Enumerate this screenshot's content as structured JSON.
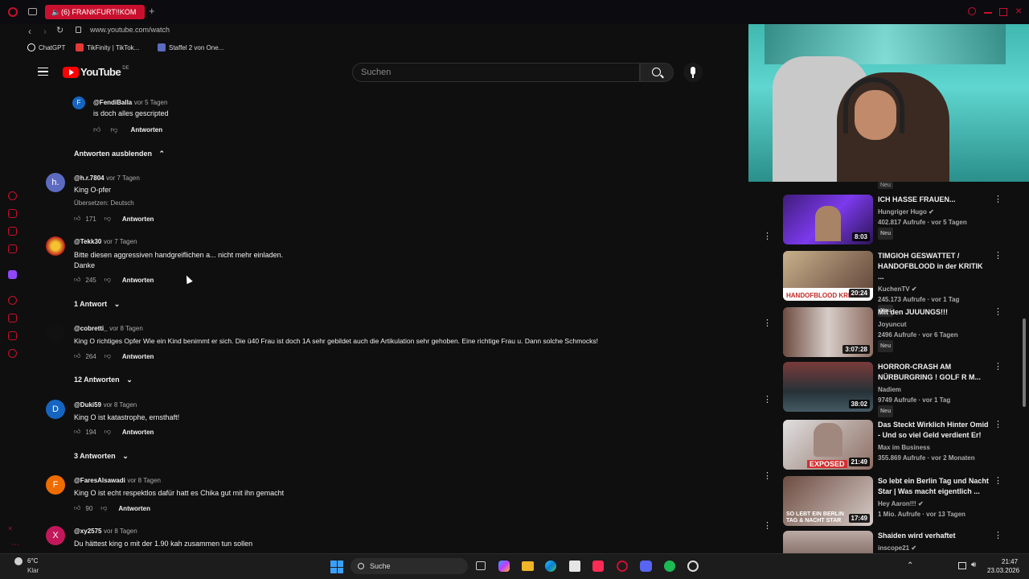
{
  "browser": {
    "tab_title": "(6) FRANKFURT!!KOM",
    "url": "www.youtube.com/watch",
    "bookmarks": [
      {
        "label": "ChatGPT",
        "color": "#ffffff"
      },
      {
        "label": "TikFinity | TikTok...",
        "color": "#e53935"
      },
      {
        "label": "Staffel 2 von One...",
        "color": "#5c6bc0"
      }
    ]
  },
  "youtube": {
    "logo_text": "YouTube",
    "region": "DE",
    "search_placeholder": "Suchen"
  },
  "comments": [
    {
      "author": "@FendiBalla",
      "time": "vor 5 Tagen",
      "text": "is doch alles gescripted",
      "likes": "",
      "reply": "Antworten",
      "avatar_letter": "F",
      "avatar_color": "#1565c0"
    },
    {
      "author": "@h.r.7804",
      "time": "vor 7 Tagen",
      "text": "King O-pfer",
      "translate": "Übersetzen: Deutsch",
      "likes": "171",
      "reply": "Antworten",
      "avatar_letter": "h.",
      "avatar_color": "#5c6bc0"
    },
    {
      "author": "@Tekk30",
      "time": "vor 7 Tagen",
      "text": "Bitte diesen aggressiven handgreiflichen a...  nicht mehr einladen.",
      "text2": "Danke",
      "likes": "245",
      "reply": "Antworten",
      "avatar_letter": "",
      "avatar_color": "#b71c1c"
    },
    {
      "author": "@cobretti_",
      "time": "vor 8 Tagen",
      "text": "King O richtiges Opfer Wie ein Kind benimmt er sich. Die ü40 Frau ist doch 1A sehr gebildet auch die Artikulation sehr gehoben. Eine richtige Frau u. Dann solche Schmocks!",
      "likes": "264",
      "reply": "Antworten",
      "avatar_letter": "",
      "avatar_color": "#111111"
    },
    {
      "author": "@Duki59",
      "time": "vor 8 Tagen",
      "text": "King O ist katastrophe, ernsthaft!",
      "likes": "194",
      "reply": "Antworten",
      "avatar_letter": "D",
      "avatar_color": "#1565c0"
    },
    {
      "author": "@FaresAlsawadi",
      "time": "vor 8 Tagen",
      "text": "King O ist  echt respektlos dafür hatt es Chika gut mit ihn gemacht",
      "likes": "90",
      "reply": "Antworten",
      "avatar_letter": "F",
      "avatar_color": "#ef6c00"
    },
    {
      "author": "@xy2575",
      "time": "vor 8 Tagen",
      "text": "Du hättest king o mit der 1.90 kah zusammen tun sollen",
      "likes": "",
      "reply": "",
      "avatar_letter": "X",
      "avatar_color": "#c2185b"
    }
  ],
  "expanders": {
    "hide_replies": "Antworten ausblenden",
    "r1": "1 Antwort",
    "r2": "12 Antworten",
    "r3": "3 Antworten"
  },
  "recommendations": [
    {
      "title": "ICH HASSE FRAUEN...",
      "channel": "Hungriger Hugo",
      "meta": "402.817 Aufrufe · vor 5 Tagen",
      "badge": "Neu",
      "duration": "8:03",
      "thumb_color": "#5e35b1"
    },
    {
      "title": "TIMGIOH GESWATTET / HANDOFBLOOD in der KRITIK ...",
      "channel": "KuchenTV",
      "meta": "245.173 Aufrufe · vor 1 Tag",
      "badge": "Neu",
      "duration": "20:24",
      "thumb_color": "#6d4c41"
    },
    {
      "title": "Mit den JUUUNGS!!!",
      "channel": "Joyuncut",
      "meta": "2496 Aufrufe · vor 6 Tagen",
      "badge": "Neu",
      "duration": "3:07:28",
      "thumb_color": "#8d6e63"
    },
    {
      "title": "HORROR-CRASH AM NÜRBURGRING ! GOLF R M...",
      "channel": "Nadiem",
      "meta": "9749 Aufrufe · vor 1 Tag",
      "badge": "Neu",
      "duration": "38:02",
      "thumb_color": "#455a64"
    },
    {
      "title": "Das Steckt Wirklich Hinter Omid - Und so viel Geld verdient Er!",
      "channel": "Max im Business",
      "meta": "355.869 Aufrufe · vor 2 Monaten",
      "badge": "",
      "duration": "21:49",
      "thumb_color": "#8d6e63",
      "overlay": "EXPOSED"
    },
    {
      "title": "So lebt ein Berlin Tag und Nacht Star | Was macht eigentlich ...",
      "channel": "Hey Aaron!!!",
      "meta": "1 Mio. Aufrufe · vor 13 Tagen",
      "badge": "",
      "duration": "17:49",
      "thumb_color": "#795548",
      "overlay": "SO LEBT EIN BERLIN TAG & NACHT STAR"
    },
    {
      "title": "Shaiden wird verhaftet",
      "channel": "inscope21",
      "meta": "",
      "badge": "",
      "duration": "",
      "thumb_color": "#4e342e"
    }
  ],
  "top_badge": "Neu",
  "taskbar": {
    "weather_temp": "6°C",
    "weather_text": "Klar",
    "search_label": "Suche",
    "time": "21:47",
    "date": "23.03.2026"
  }
}
